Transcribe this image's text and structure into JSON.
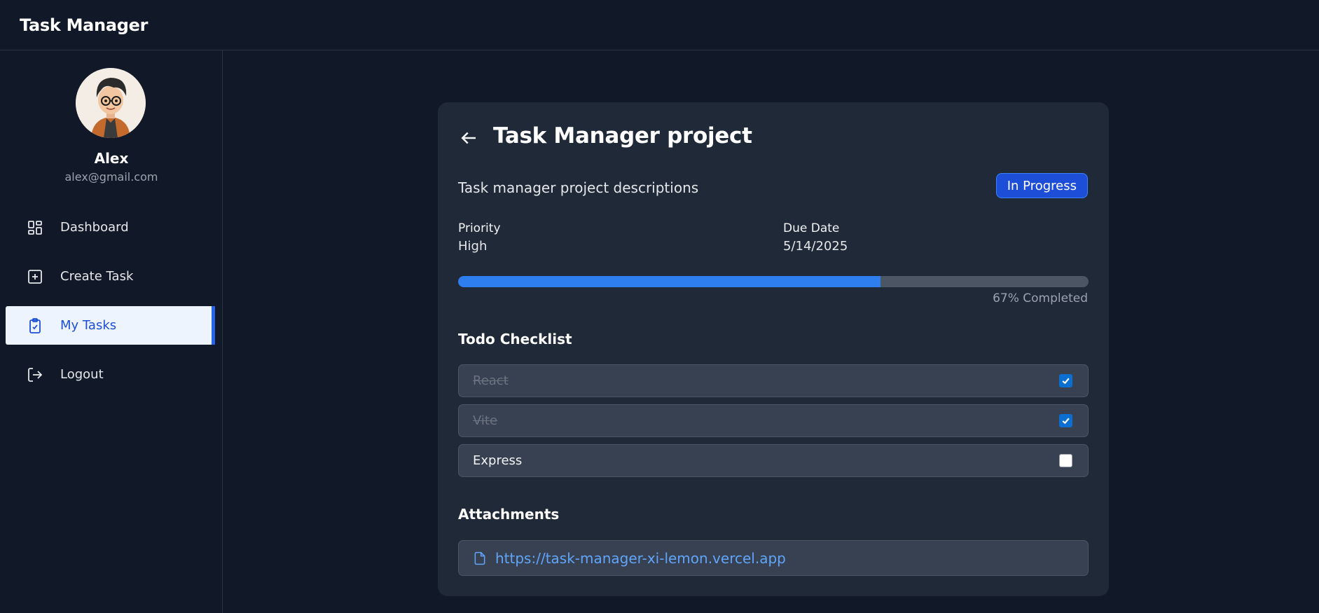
{
  "app": {
    "title": "Task Manager"
  },
  "user": {
    "name": "Alex",
    "email": "alex@gmail.com"
  },
  "sidebar": {
    "items": [
      {
        "label": "Dashboard",
        "icon": "dashboard-icon"
      },
      {
        "label": "Create Task",
        "icon": "plus-square-icon"
      },
      {
        "label": "My Tasks",
        "icon": "clipboard-check-icon",
        "active": true
      },
      {
        "label": "Logout",
        "icon": "logout-icon"
      }
    ]
  },
  "task": {
    "title": "Task Manager project",
    "description": "Task manager project descriptions",
    "status": "In Progress",
    "priority_label": "Priority",
    "priority": "High",
    "due_label": "Due Date",
    "due_date": "5/14/2025",
    "progress": 67,
    "progress_text": "67% Completed",
    "checklist_title": "Todo Checklist",
    "checklist": [
      {
        "text": "React",
        "done": true
      },
      {
        "text": "Vite",
        "done": true
      },
      {
        "text": "Express",
        "done": false
      }
    ],
    "attachments_title": "Attachments",
    "attachments": [
      {
        "url": "https://task-manager-xi-lemon.vercel.app",
        "icon": "file-icon"
      }
    ]
  },
  "colors": {
    "background": "#111827",
    "card": "#1f2937",
    "accent": "#2563eb",
    "link": "#60a5fa"
  }
}
